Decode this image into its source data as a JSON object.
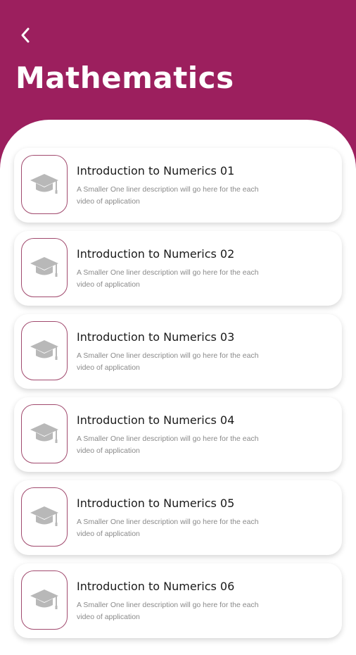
{
  "header": {
    "back_icon": "chevron-left-icon",
    "title": "Mathematics",
    "background_color": "#9c1f5e"
  },
  "videos": [
    {
      "title": "Introduction to Numerics 01",
      "description": "A Smaller One liner description will go here for the each video of application",
      "icon": "graduation-cap-icon"
    },
    {
      "title": "Introduction to Numerics 02",
      "description": "A Smaller One liner description will go here for the each video of application",
      "icon": "graduation-cap-icon"
    },
    {
      "title": "Introduction to Numerics 03",
      "description": "A Smaller One liner description will go here for the each video of application",
      "icon": "graduation-cap-icon"
    },
    {
      "title": "Introduction to Numerics 04",
      "description": "A Smaller One liner description will go here for the each video of application",
      "icon": "graduation-cap-icon"
    },
    {
      "title": "Introduction to Numerics 05",
      "description": "A Smaller One liner description will go here for the each video of application",
      "icon": "graduation-cap-icon"
    },
    {
      "title": "Introduction to Numerics 06",
      "description": "A Smaller One liner description will go here for the each video of application",
      "icon": "graduation-cap-icon"
    }
  ]
}
